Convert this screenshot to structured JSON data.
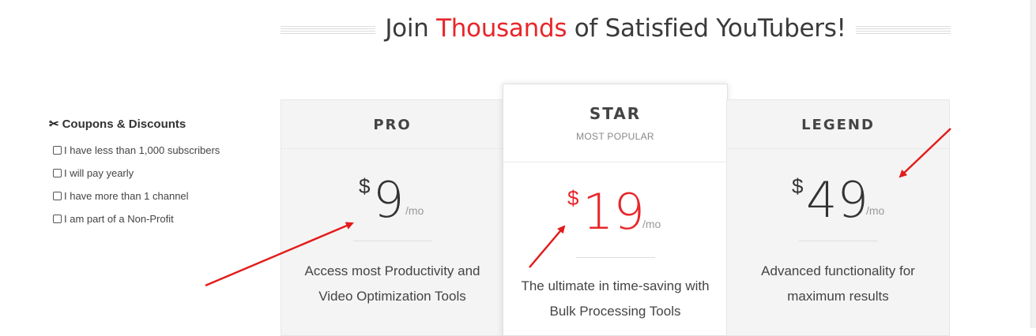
{
  "headline": {
    "before": "Join ",
    "highlight": "Thousands",
    "after": " of Satisfied YouTubers!"
  },
  "coupons": {
    "title": "Coupons & Discounts",
    "icon": "scissors-icon",
    "options": [
      "I have less than 1,000 subscribers",
      "I will pay yearly",
      "I have more than 1 channel",
      "I am part of a Non-Profit"
    ]
  },
  "plans": [
    {
      "name": "PRO",
      "currency": "$",
      "amount": "9",
      "period": "/mo",
      "desc1": "Access most Productivity and",
      "desc2": "Video Optimization Tools"
    },
    {
      "name": "STAR",
      "subtitle": "MOST POPULAR",
      "currency": "$",
      "amount": "19",
      "period": "/mo",
      "desc1": "The ultimate in time-saving with",
      "desc2": "Bulk Processing Tools"
    },
    {
      "name": "LEGEND",
      "currency": "$",
      "amount": "49",
      "period": "/mo",
      "desc1": "Advanced functionality for",
      "desc2": "maximum results"
    }
  ],
  "colors": {
    "accent": "#e8262a",
    "arrow": "#e31b1b"
  }
}
